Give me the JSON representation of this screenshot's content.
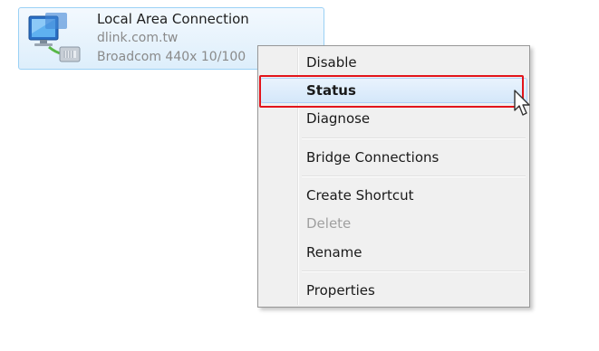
{
  "connection": {
    "name": "Local Area Connection",
    "network": "dlink.com.tw",
    "adapter": "Broadcom 440x 10/100"
  },
  "menu": {
    "items": [
      {
        "label": "Disable",
        "bold": false,
        "disabled": false
      },
      {
        "label": "Status",
        "bold": true,
        "disabled": false,
        "highlighted": true
      },
      {
        "label": "Diagnose",
        "bold": false,
        "disabled": false
      },
      {
        "label": "Bridge Connections",
        "bold": false,
        "disabled": false
      },
      {
        "label": "Create Shortcut",
        "bold": false,
        "disabled": false
      },
      {
        "label": "Delete",
        "bold": false,
        "disabled": true
      },
      {
        "label": "Rename",
        "bold": false,
        "disabled": false
      },
      {
        "label": "Properties",
        "bold": false,
        "disabled": false
      }
    ]
  },
  "colors": {
    "highlight_border": "#e2141b",
    "tile_border": "#9bd1f5",
    "disabled_text": "#a0a0a0"
  }
}
